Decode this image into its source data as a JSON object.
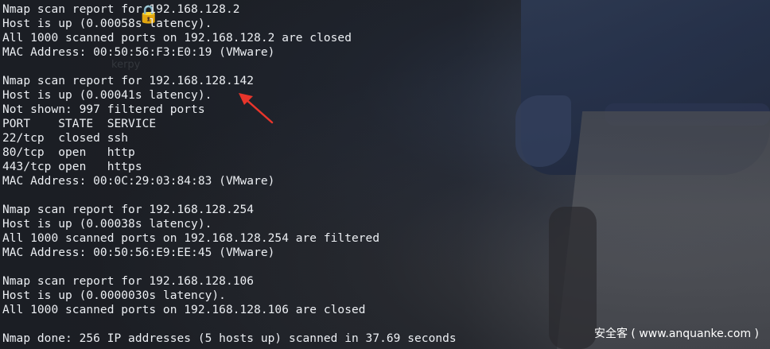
{
  "terminal": {
    "lines": [
      "Nmap scan report for 192.168.128.2",
      "Host is up (0.00058s latency).",
      "All 1000 scanned ports on 192.168.128.2 are closed",
      "MAC Address: 00:50:56:F3:E0:19 (VMware)",
      "",
      "Nmap scan report for 192.168.128.142",
      "Host is up (0.00041s latency).",
      "Not shown: 997 filtered ports",
      "PORT    STATE  SERVICE",
      "22/tcp  closed ssh",
      "80/tcp  open   http",
      "443/tcp open   https",
      "MAC Address: 00:0C:29:03:84:83 (VMware)",
      "",
      "Nmap scan report for 192.168.128.254",
      "Host is up (0.00038s latency).",
      "All 1000 scanned ports on 192.168.128.254 are filtered",
      "MAC Address: 00:50:56:E9:EE:45 (VMware)",
      "",
      "Nmap scan report for 192.168.128.106",
      "Host is up (0.0000030s latency).",
      "All 1000 scanned ports on 192.168.128.106 are closed",
      "",
      "Nmap done: 256 IP addresses (5 hosts up) scanned in 37.69 seconds"
    ]
  },
  "annotation": {
    "arrow_color": "#e8352b",
    "arrow_icon": "red-arrow-icon"
  },
  "watermark": {
    "text": "安全客 ( www.anquanke.com )"
  },
  "background": {
    "logo_text": "kerpy"
  },
  "colors": {
    "text": "#eceff3",
    "background": "#1c1f25"
  }
}
